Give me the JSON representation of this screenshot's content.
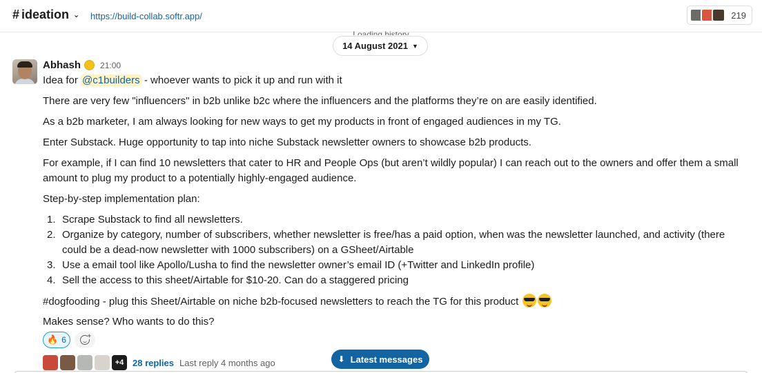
{
  "header": {
    "channel_hash": "#",
    "channel_name": "ideation",
    "channel_url": "https://build-collab.softr.app/",
    "member_count": "219"
  },
  "history": {
    "loading_text": "Loading history",
    "date_label": "14 August 2021"
  },
  "message": {
    "author": "Abhash",
    "time": "21:00",
    "line1_prefix": "Idea for",
    "mention": "@c1builders",
    "line1_suffix": "- whoever wants to pick it up and run with it",
    "p1": "There are very few \"influencers\" in b2b unlike b2c where the influencers and the platforms they’re on are easily identified.",
    "p2": "As a b2b marketer, I am always looking for new ways to get my products in front of engaged audiences in my TG.",
    "p3": "Enter Substack. Huge opportunity to tap into niche Substack newsletter owners to showcase b2b products.",
    "p4": "For example, if I can find 10 newsletters that cater to HR and People Ops (but aren’t wildly popular) I can reach out to the owners and offer them a small amount to plug my product to a potentially highly-engaged audience.",
    "p5": "Step-by-step implementation plan:",
    "plan": [
      {
        "num": "1.",
        "text": "Scrape Substack to find all newsletters."
      },
      {
        "num": "2.",
        "text": "Organize by category, number of subscribers, whether newsletter is free/has a paid option, when was the newsletter launched, and activity (there could be a dead-now newsletter with 1000 subscribers) on a GSheet/Airtable"
      },
      {
        "num": "3.",
        "text": "Use a email tool like Apollo/Lusha to find the newsletter owner’s email ID (+Twitter and LinkedIn profile)"
      },
      {
        "num": "4.",
        "text": "Sell the access to this sheet/Airtable for $10-20. Can do a staggered pricing"
      }
    ],
    "p6": "#dogfooding - plug this Sheet/Airtable on niche b2b-focused newsletters to reach the TG for this product",
    "p7": "Makes sense? Who wants to do this?"
  },
  "reactions": {
    "fire_glyph": "🔥",
    "fire_count": "6"
  },
  "thread": {
    "more_count": "+4",
    "replies": "28 replies",
    "last_reply": "Last reply 4 months ago"
  },
  "jump": {
    "arrow": "⬇",
    "label": "Latest messages"
  },
  "colors": {
    "link": "#1264a3",
    "mention_bg": "#fff3c5",
    "reaction_bg": "#e8f5fa",
    "button_bg": "#1264a3"
  }
}
